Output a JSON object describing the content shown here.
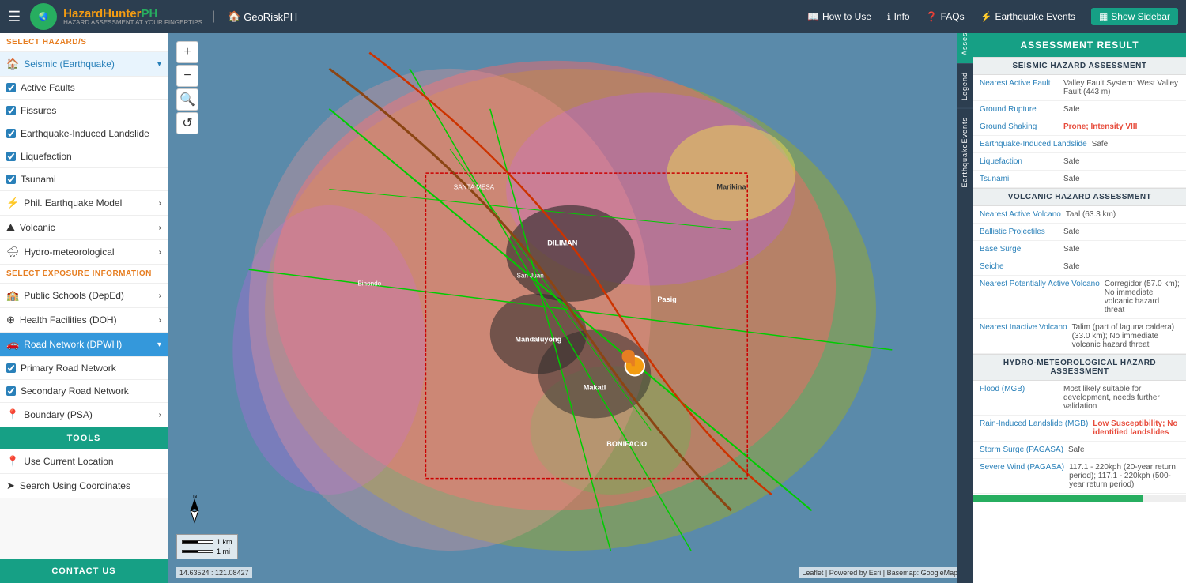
{
  "header": {
    "logo_text_hazard": "Hazard",
    "logo_text_hunter": "Hunter",
    "logo_text_ph": "PH",
    "logo_subtitle": "HAZARD ASSESSMENT AT YOUR FINGERTIPS",
    "georiskph_label": "GeoRiskPH",
    "nav": {
      "how_to_use": "How to Use",
      "info": "Info",
      "faqs": "FAQs",
      "earthquake_events": "Earthquake Events",
      "show_sidebar": "Show Sidebar"
    }
  },
  "sidebar": {
    "select_hazard_title": "SELECT HAZARD/S",
    "select_exposure_title": "SELECT EXPOSURE INFORMATION",
    "tools_label": "TOOLS",
    "contact_label": "CONTACT US",
    "hazard_items": [
      {
        "id": "seismic",
        "label": "Seismic (Earthquake)",
        "type": "dropdown",
        "active": true,
        "icon": "🏠"
      },
      {
        "id": "active_faults",
        "label": "Active Faults",
        "type": "checkbox",
        "checked": true
      },
      {
        "id": "fissures",
        "label": "Fissures",
        "type": "checkbox",
        "checked": true
      },
      {
        "id": "eq_landslide",
        "label": "Earthquake-Induced Landslide",
        "type": "checkbox",
        "checked": true
      },
      {
        "id": "liquefaction",
        "label": "Liquefaction",
        "type": "checkbox",
        "checked": true
      },
      {
        "id": "tsunami",
        "label": "Tsunami",
        "type": "checkbox",
        "checked": true
      },
      {
        "id": "phil_eq_model",
        "label": "Phil. Earthquake Model",
        "type": "arrow",
        "icon": "⚡"
      },
      {
        "id": "volcanic",
        "label": "Volcanic",
        "type": "arrow",
        "icon": "⛰"
      },
      {
        "id": "hydro_meteo",
        "label": "Hydro-meteorological",
        "type": "arrow",
        "icon": "🌧"
      }
    ],
    "exposure_items": [
      {
        "id": "public_schools",
        "label": "Public Schools (DepEd)",
        "type": "arrow",
        "icon": "🏫"
      },
      {
        "id": "health_facilities",
        "label": "Health Facilities (DOH)",
        "type": "arrow",
        "icon": "🏥"
      },
      {
        "id": "road_network",
        "label": "Road Network (DPWH)",
        "type": "dropdown",
        "active": true,
        "icon": "🚗"
      },
      {
        "id": "primary_road",
        "label": "Primary Road Network",
        "type": "checkbox",
        "checked": true
      },
      {
        "id": "secondary_road",
        "label": "Secondary Road Network",
        "type": "checkbox",
        "checked": true
      },
      {
        "id": "boundary",
        "label": "Boundary (PSA)",
        "type": "arrow",
        "icon": "📍"
      }
    ],
    "tool_items": [
      {
        "id": "current_location",
        "label": "Use Current Location",
        "icon": "📍"
      },
      {
        "id": "search_coords",
        "label": "Search Using Coordinates",
        "icon": "➤"
      }
    ]
  },
  "assessment": {
    "header": "ASSESSMENT RESULT",
    "seismic_section": "SEISMIC HAZARD ASSESSMENT",
    "seismic_rows": [
      {
        "label": "Nearest Active Fault",
        "value": "Valley Fault System: West Valley Fault (443 m)",
        "color": "normal"
      },
      {
        "label": "Ground Rupture",
        "value": "Safe",
        "color": "safe"
      },
      {
        "label": "Ground Shaking",
        "value": "Prone; Intensity VIII",
        "color": "prone"
      },
      {
        "label": "Earthquake-Induced Landslide",
        "value": "Safe",
        "color": "safe"
      },
      {
        "label": "Liquefaction",
        "value": "Safe",
        "color": "safe"
      },
      {
        "label": "Tsunami",
        "value": "Safe",
        "color": "safe"
      }
    ],
    "volcanic_section": "VOLCANIC HAZARD ASSESSMENT",
    "volcanic_rows": [
      {
        "label": "Nearest Active Volcano",
        "value": "Taal (63.3 km)",
        "color": "normal"
      },
      {
        "label": "Ballistic Projectiles",
        "value": "Safe",
        "color": "safe"
      },
      {
        "label": "Base Surge",
        "value": "Safe",
        "color": "safe"
      },
      {
        "label": "Seiche",
        "value": "Safe",
        "color": "safe"
      },
      {
        "label": "Nearest Potentially Active Volcano",
        "value": "Corregidor (57.0 km); No immediate volcanic hazard threat",
        "color": "normal"
      },
      {
        "label": "Nearest Inactive Volcano",
        "value": "Talim (part of laguna caldera) (33.0 km); No immediate volcanic hazard threat",
        "color": "normal"
      }
    ],
    "hydro_section": "HYDRO-METEOROLOGICAL HAZARD ASSESSMENT",
    "hydro_rows": [
      {
        "label": "Flood (MGB)",
        "value": "Most likely suitable for development, needs further validation",
        "color": "normal"
      },
      {
        "label": "Rain-Induced Landslide (MGB)",
        "value": "Low Susceptibility; No identified landslides",
        "color": "red"
      },
      {
        "label": "Storm Surge (PAGASA)",
        "value": "Safe",
        "color": "safe"
      },
      {
        "label": "Severe Wind (PAGASA)",
        "value": "117.1 - 220kph (20-year return period); 117.1 - 220kph (500-year return period)",
        "color": "normal"
      }
    ],
    "progress_value": 80,
    "vertical_tabs": [
      "Assessment",
      "Legend",
      "EarthquakeEvents"
    ]
  },
  "map": {
    "coords": "14.63524 : 121.08427",
    "attribution": "Leaflet | Powered by Esri | Basemap: GoogleMap |",
    "scale_km": "1 km",
    "scale_mi": "1 mi",
    "zoom_in": "+",
    "zoom_out": "−"
  }
}
